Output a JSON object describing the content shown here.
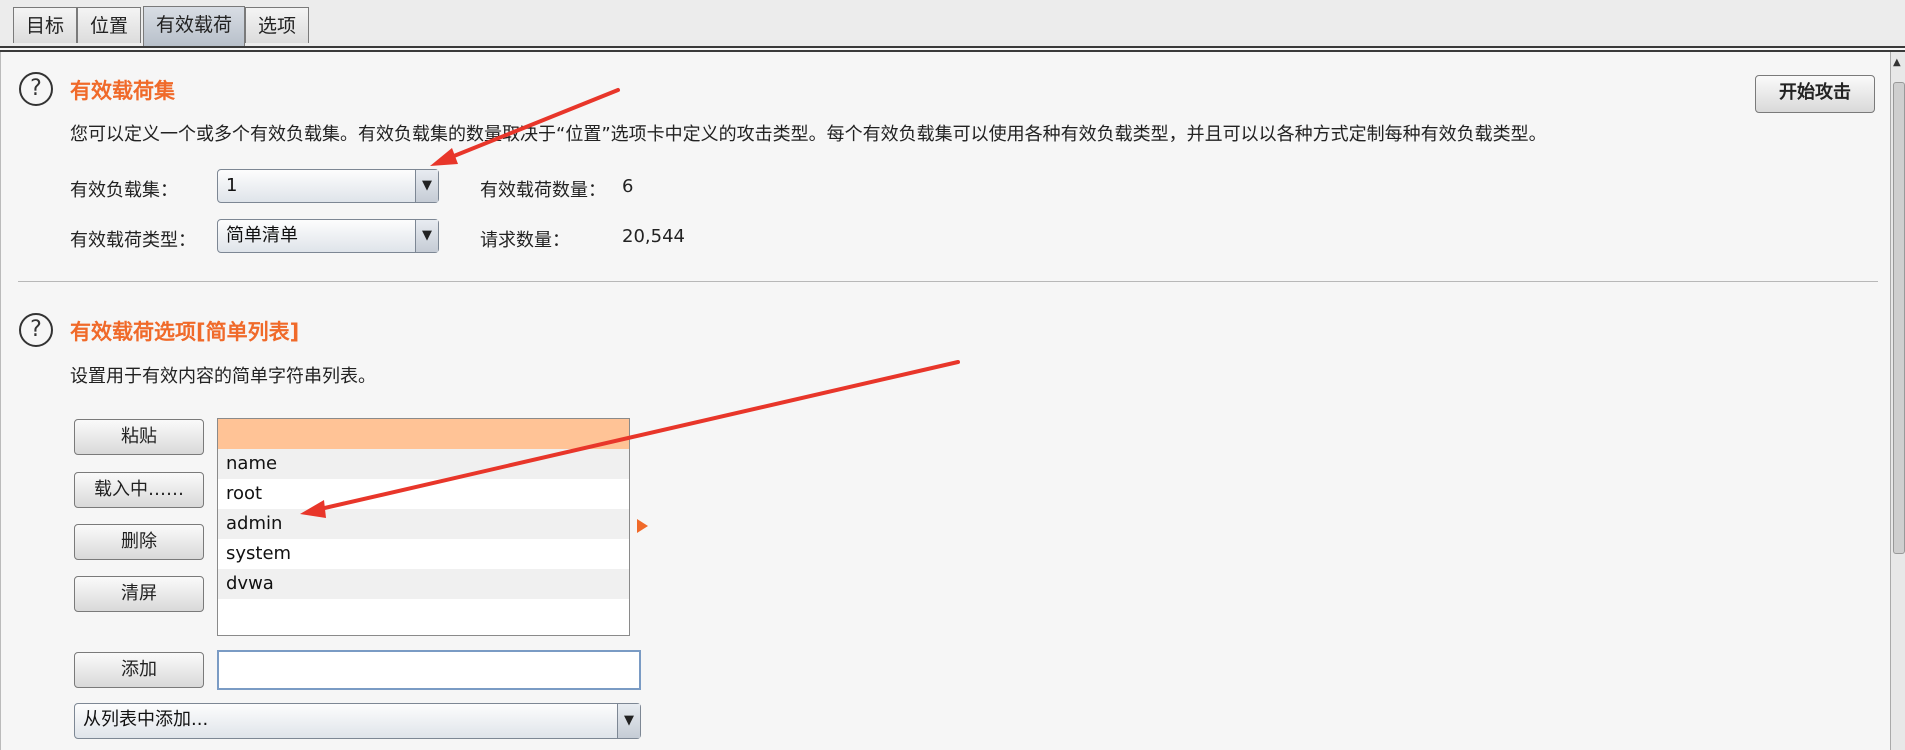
{
  "tabs": [
    {
      "label": "目标"
    },
    {
      "label": "位置"
    },
    {
      "label": "有效载荷",
      "active": true
    },
    {
      "label": "选项"
    }
  ],
  "payload_sets": {
    "title": "有效载荷集",
    "description": "您可以定义一个或多个有效负载集。有效负载集的数量取决于“位置”选项卡中定义的攻击类型。每个有效负载集可以使用各种有效负载类型，并且可以以各种方式定制每种有效负载类型。",
    "set_label": "有效负载集：",
    "set_value": "1",
    "type_label": "有效载荷类型：",
    "type_value": "简单清单",
    "count_label": "有效载荷数量：",
    "count_value": "6",
    "requests_label": "请求数量：",
    "requests_value": "20,544"
  },
  "start_attack_label": "开始攻击",
  "payload_options": {
    "title": "有效载荷选项[简单列表]",
    "description": "设置用于有效内容的简单字符串列表。",
    "buttons": {
      "paste": "粘贴",
      "load": "载入中……",
      "remove": "删除",
      "clear": "清屏",
      "add": "添加"
    },
    "list_items": [
      "",
      "name",
      "root",
      "admin",
      "system",
      "dvwa"
    ],
    "add_input_value": "",
    "add_from_list": "从列表中添加..."
  },
  "colors": {
    "accent": "#f06a2a",
    "selection": "#ffc396",
    "annotation_arrow": "#e8362a"
  },
  "icons": {
    "help": "question-circle-icon",
    "dropdown": "triangle-down-icon",
    "expand": "play-triangle-icon"
  }
}
